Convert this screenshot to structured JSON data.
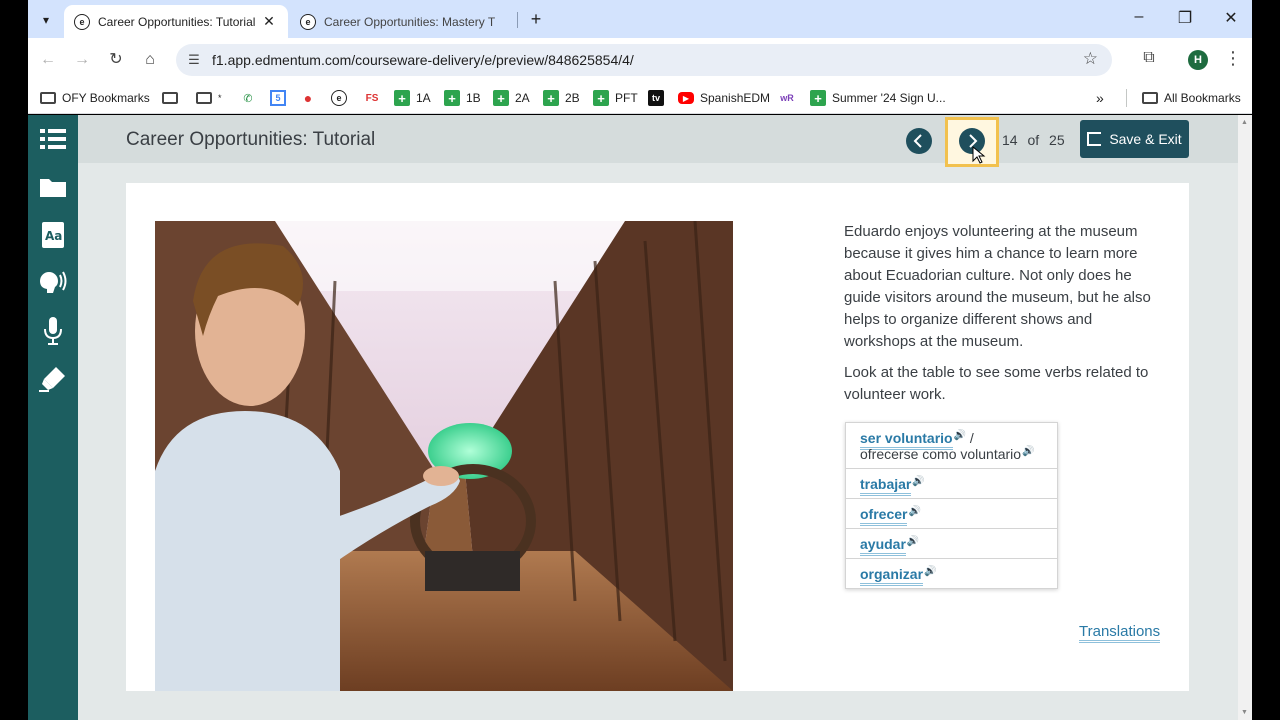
{
  "browser": {
    "tabs": [
      {
        "title": "Career Opportunities: Tutorial",
        "active": true
      },
      {
        "title": "Career Opportunities: Mastery T",
        "active": false
      }
    ],
    "url": "f1.app.edmentum.com/courseware-delivery/e/preview/848625854/4/",
    "profile_initial": "H",
    "bookmarks": [
      {
        "label": "OFY Bookmarks",
        "icon": "folder-gear-icon"
      },
      {
        "label": "",
        "icon": "folder-icon"
      },
      {
        "label": "*",
        "icon": "folder-icon"
      },
      {
        "label": "",
        "icon": "phone-icon"
      },
      {
        "label": "",
        "icon": "calendar-icon"
      },
      {
        "label": "",
        "icon": "apple-icon"
      },
      {
        "label": "",
        "icon": "edmentum-icon"
      },
      {
        "label": "FS",
        "icon": "text-icon"
      },
      {
        "label": "1A",
        "icon": "sheets-icon"
      },
      {
        "label": "1B",
        "icon": "sheets-icon"
      },
      {
        "label": "2A",
        "icon": "sheets-icon"
      },
      {
        "label": "2B",
        "icon": "sheets-icon"
      },
      {
        "label": "PFT",
        "icon": "sheets-icon"
      },
      {
        "label": "",
        "icon": "tv-icon"
      },
      {
        "label": "SpanishEDM",
        "icon": "youtube-icon"
      },
      {
        "label": "",
        "icon": "wr-icon"
      },
      {
        "label": "Summer '24 Sign U...",
        "icon": "sheets-icon"
      }
    ],
    "all_bookmarks": "All Bookmarks"
  },
  "app": {
    "title": "Career Opportunities: Tutorial",
    "pager": {
      "current": "14",
      "of": "of",
      "total": "25"
    },
    "save_exit": "Save & Exit",
    "paragraphs": [
      "Eduardo enjoys volunteering at the museum because it gives him a chance to learn more about Ecuadorian culture. Not only does he guide visitors around the museum, but he also helps to organize different shows and workshops at the museum.",
      "Look at the table to see some verbs related to volunteer work."
    ],
    "verbs": {
      "row1_a": "ser voluntario",
      "row1_sep": " /",
      "row1_b": "ofrecerse como voluntario",
      "row2": "trabajar",
      "row3": "ofrecer",
      "row4": "ayudar",
      "row5": "organizar"
    },
    "translations": "Translations"
  }
}
